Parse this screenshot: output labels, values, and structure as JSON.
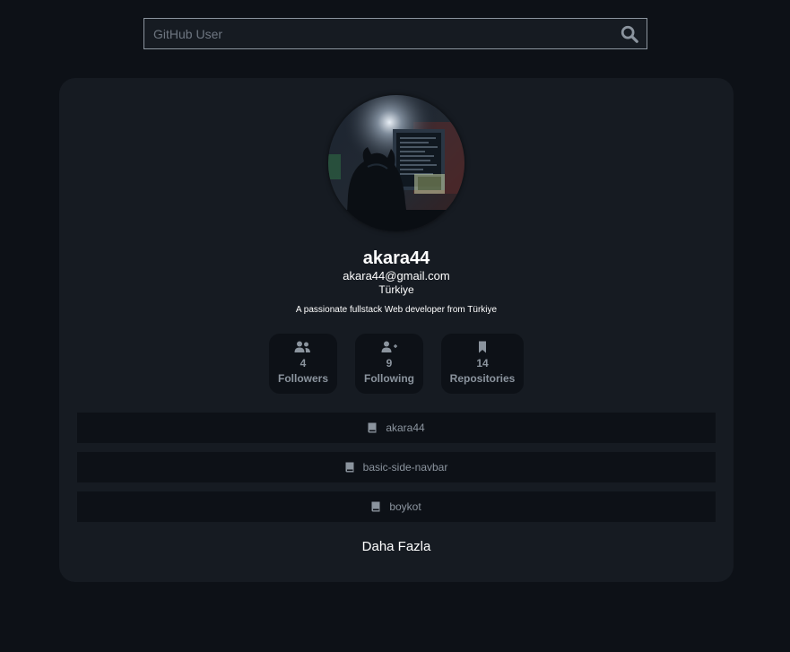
{
  "search": {
    "placeholder": "GitHub User",
    "value": "",
    "icon": "search-icon"
  },
  "profile": {
    "username": "akara44",
    "email": "akara44@gmail.com",
    "location": "Türkiye",
    "bio": "A passionate fullstack Web developer from Türkiye",
    "avatar_icon": "avatar-hooded-figure-at-computer"
  },
  "stats": [
    {
      "icon": "people-icon",
      "count": "4",
      "label": "Followers"
    },
    {
      "icon": "user-plus-icon",
      "count": "9",
      "label": "Following"
    },
    {
      "icon": "bookmark-icon",
      "count": "14",
      "label": "Repositories"
    }
  ],
  "repos": [
    {
      "icon": "book-icon",
      "name": "akara44"
    },
    {
      "icon": "book-icon",
      "name": "basic-side-navbar"
    },
    {
      "icon": "book-icon",
      "name": "boykot"
    }
  ],
  "more_label": "Daha Fazla",
  "colors": {
    "background": "#0d1117",
    "card": "#161b22",
    "muted_text": "#8b949e"
  }
}
